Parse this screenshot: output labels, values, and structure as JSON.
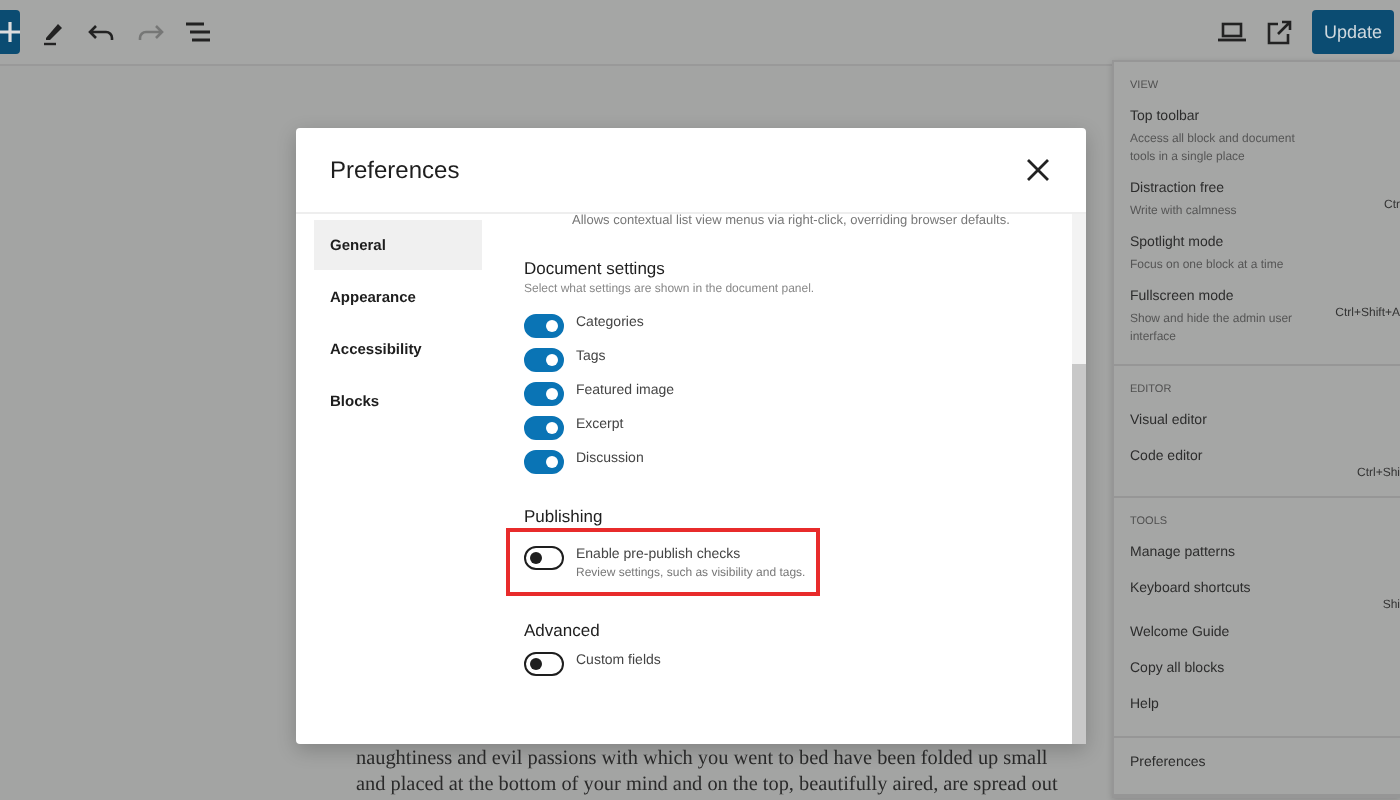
{
  "toolbar": {
    "left": [
      {
        "kind": "add"
      },
      {
        "kind": "edit"
      },
      {
        "kind": "undo",
        "disabled": false
      },
      {
        "kind": "redo",
        "disabled": true
      },
      {
        "kind": "outline"
      }
    ],
    "update_button": "Update"
  },
  "editor_text": [
    "naughtiness and evil passions with which you went to bed have been folded up small",
    "and placed at the bottom of your mind and on the top, beautifully aired, are spread out"
  ],
  "options_menu": {
    "groups": [
      {
        "heading": "VIEW",
        "items": [
          {
            "label": "Top toolbar",
            "description": "Access all block and document tools in a single place"
          },
          {
            "label": "Distraction free",
            "description": "Write with calmness",
            "shortcut": "Ctr"
          },
          {
            "label": "Spotlight mode",
            "description": "Focus on one block at a time"
          },
          {
            "label": "Fullscreen mode",
            "description": "Show and hide the admin user interface",
            "shortcut": "Ctrl+Shift+A"
          }
        ]
      },
      {
        "heading": "EDITOR",
        "items": [
          {
            "label": "Visual editor"
          },
          {
            "label": "Code editor",
            "shortcut": "Ctrl+Shi"
          }
        ]
      },
      {
        "heading": "TOOLS",
        "items": [
          {
            "label": "Manage patterns"
          },
          {
            "label": "Keyboard shortcuts",
            "shortcut": "Shi"
          },
          {
            "label": "Welcome Guide"
          },
          {
            "label": "Copy all blocks"
          },
          {
            "label": "Help"
          }
        ]
      },
      {
        "items": [
          {
            "label": "Preferences"
          }
        ]
      }
    ]
  },
  "modal": {
    "title": "Preferences",
    "nav": [
      {
        "label": "General",
        "selected": true
      },
      {
        "label": "Appearance",
        "selected": false
      },
      {
        "label": "Accessibility",
        "selected": false
      },
      {
        "label": "Blocks",
        "selected": false
      }
    ],
    "cut_text": "Allows contextual list view menus via right-click, overriding browser defaults.",
    "sections": [
      {
        "title": "Document settings",
        "description": "Select what settings are shown in the document panel.",
        "options": [
          {
            "label": "Categories",
            "on": true
          },
          {
            "label": "Tags",
            "on": true
          },
          {
            "label": "Featured image",
            "on": true
          },
          {
            "label": "Excerpt",
            "on": true
          },
          {
            "label": "Discussion",
            "on": true
          }
        ]
      },
      {
        "title": "Publishing",
        "options": [
          {
            "label": "Enable pre-publish checks",
            "description": "Review settings, such as visibility and tags.",
            "on": false,
            "highlighted": true
          }
        ]
      },
      {
        "title": "Advanced",
        "options": [
          {
            "label": "Custom fields",
            "on": false
          }
        ]
      }
    ]
  }
}
